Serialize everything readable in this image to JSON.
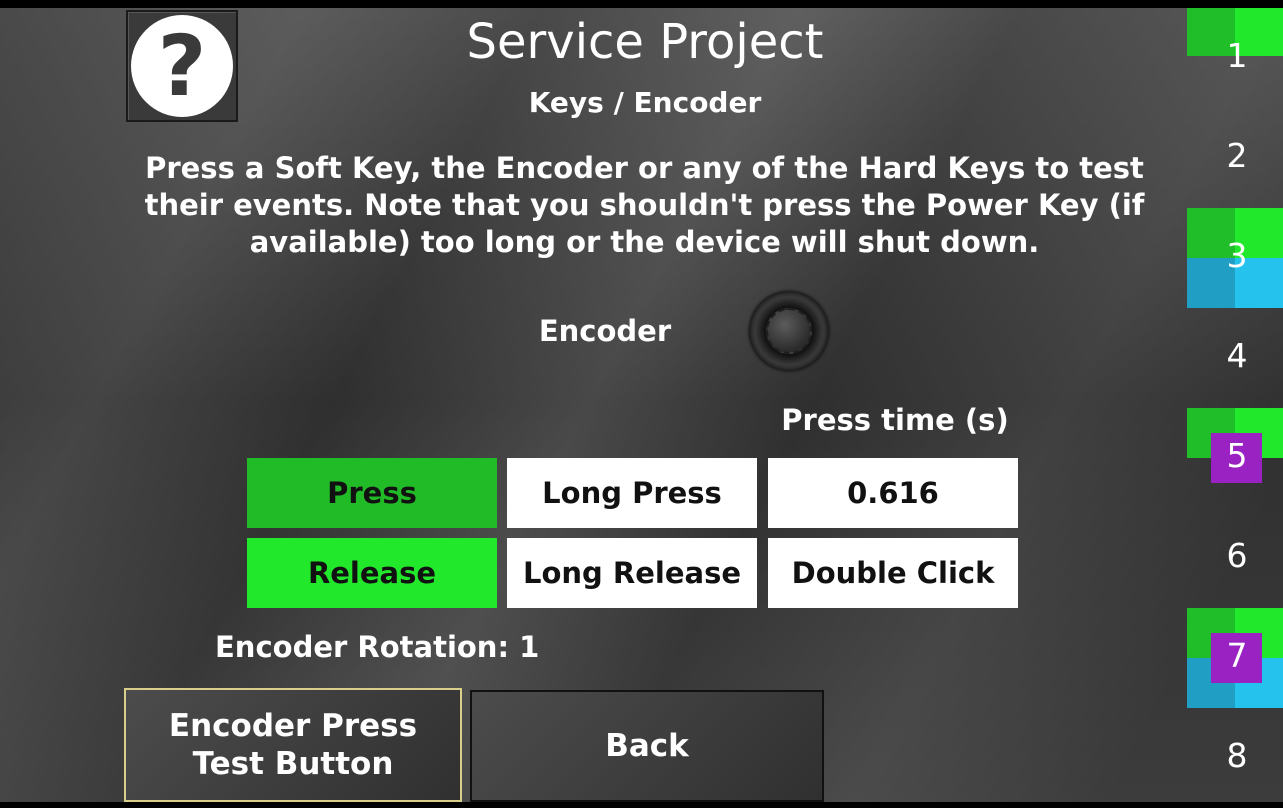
{
  "header": {
    "title": "Service Project",
    "subtitle": "Keys / Encoder",
    "help_icon": "question-mark-icon",
    "help_glyph": "?"
  },
  "description": "Press a Soft Key, the Encoder or any of the Hard Keys to test their events. Note that you shouldn't press the Power Key (if available) too long or the device will shut down.",
  "encoder": {
    "label": "Encoder",
    "icon": "encoder-knob-icon"
  },
  "events": {
    "press_time_label": "Press time (s)",
    "press": "Press",
    "long_press": "Long Press",
    "press_time_value": "0.616",
    "release": "Release",
    "long_release": "Long Release",
    "double_click": "Double Click",
    "colors": {
      "press_active": "#22bb28",
      "release_active": "#22e82c",
      "inactive": "#ffffff"
    }
  },
  "rotation": {
    "label": "Encoder Rotation:",
    "value": "1"
  },
  "buttons": {
    "encoder_press_line1": "Encoder Press",
    "encoder_press_line2": "Test Button",
    "back": "Back"
  },
  "soft_keys": [
    {
      "label": "1",
      "indicators": [
        "green"
      ]
    },
    {
      "label": "2",
      "indicators": []
    },
    {
      "label": "3",
      "indicators": [
        "green",
        "blue"
      ]
    },
    {
      "label": "4",
      "indicators": []
    },
    {
      "label": "5",
      "indicators": [
        "green",
        "purple"
      ]
    },
    {
      "label": "6",
      "indicators": []
    },
    {
      "label": "7",
      "indicators": [
        "green",
        "blue",
        "purple"
      ]
    },
    {
      "label": "8",
      "indicators": []
    }
  ],
  "indicator_colors": {
    "green_dark": "#20bf2a",
    "green_light": "#22e82c",
    "blue_dark": "#209ec4",
    "blue_light": "#25c2ee",
    "purple": "#9b22c2"
  }
}
